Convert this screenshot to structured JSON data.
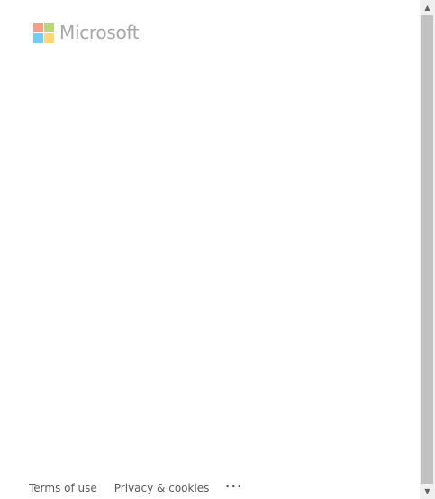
{
  "brand": {
    "name": "Microsoft",
    "logo_colors": [
      "#f25022",
      "#7fba00",
      "#00a4ef",
      "#ffb900"
    ]
  },
  "footer": {
    "terms": "Terms of use",
    "privacy": "Privacy & cookies",
    "more": "···"
  },
  "scrollbar": {
    "up_icon": "▲",
    "down_icon": "▼"
  }
}
